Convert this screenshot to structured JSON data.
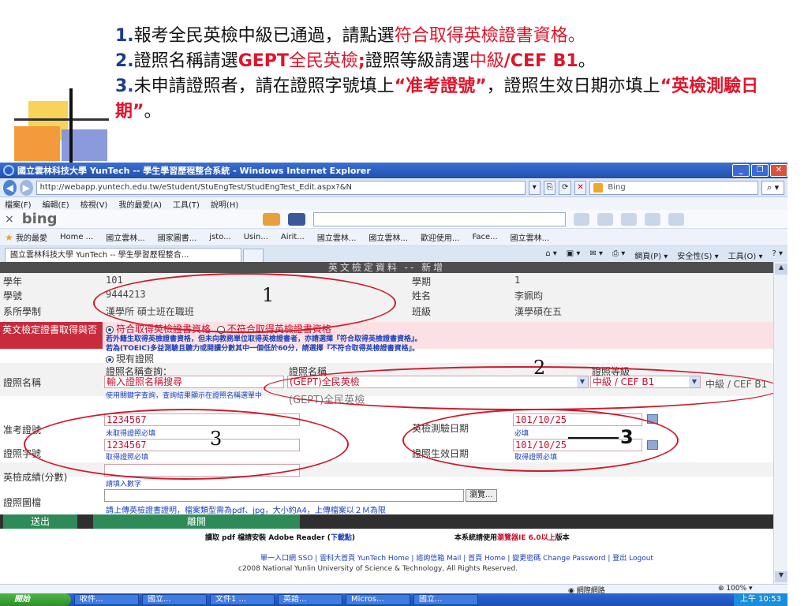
{
  "instructions": {
    "line1": {
      "num": "1.",
      "text": "報考全民英檢中級已通過，請點選",
      "red": "符合取得英檢證書資格",
      "end": "。"
    },
    "line2": {
      "num": "2.",
      "text1": "證照名稱請選",
      "bred1": "GEPT",
      "red1": "全民英檢",
      "bred2": ";",
      "text2": "證照等級請選",
      "red2": "中級",
      "bred3": "/CEF B1",
      "end": "。"
    },
    "line3": {
      "num": "3.",
      "text1": "未申請證照者，請在證照字號填上",
      "bred1": "“准考證號”",
      "text2": "，證照生效日期亦填上",
      "bred2": "“英檢測驗日期”",
      "end": "。"
    }
  },
  "window": {
    "title": "國立雲林科技大學 YunTech -- 學生學習歷程整合系統 - Windows Internet Explorer",
    "url": "http://webapp.yuntech.edu.tw/eStudent/StuEngTest/StudEngTest_Edit.aspx?&N",
    "search_placeholder": "Bing",
    "menu": [
      "檔案(F)",
      "編輯(E)",
      "檢視(V)",
      "我的最愛(A)",
      "工具(T)",
      "說明(H)"
    ],
    "bing_logo": "bing",
    "favorites_label": "我的最愛",
    "favorites": [
      "Home ...",
      "國立雲林...",
      "國家圖書...",
      "jsto...",
      "Usin...",
      "Airit...",
      "國立雲林...",
      "國立雲林...",
      "歡迎使用...",
      "Face...",
      "國立雲林..."
    ],
    "tab_title": "國立雲林科技大學 YunTech -- 學生學習歷程整合...",
    "cmd": [
      "網頁(P) ▾",
      "安全性(S) ▾",
      "工具(O) ▾"
    ]
  },
  "form": {
    "title": "英文檢定資料 -- 新增",
    "year_label": "學年",
    "year": "101",
    "term_label": "學期",
    "term": "1",
    "id_label": "學號",
    "id": "9444213",
    "name_label": "姓名",
    "name": "李姵昀",
    "dept_label": "系所學制",
    "dept": "漢學所 碩士班在職班",
    "class_label": "班級",
    "class": "漢學碩在五",
    "eligibility_label": "英文檢定證書取得與否",
    "eligible_option": "符合取得英檢證書資格",
    "ineligible_option": "不符合取得英檢證書資格",
    "note1": "若外籍生取得英檢證書資格，但未向教務單位取得英檢證書者，亦請選擇『符合取得英檢證書資格』。",
    "note2": "若為(TOEIC)多益測驗且聽力或閱讀分數其中一個低於60分，請選擇『不符合取得英檢證書資格』。",
    "existing_cert": "現有證照",
    "cert_name_label": "證照名稱",
    "cert_search_label": "證照名稱查詢：",
    "cert_search_value": "輸入證照名稱搜尋",
    "cert_search_hint": "使用關鍵字查詢，查詢結果顯示在證照名稱選單中",
    "cert_name_col": "證照名稱",
    "cert_name_value": "(GEPT)全民英檢",
    "cert_name_echo": "(GEPT)全民英檢",
    "cert_level_label": "證照等級",
    "cert_level_value": "中級 / CEF B1",
    "cert_level_echo": "中級 / CEF B1",
    "admission_label": "准考證號",
    "admission_value": "1234567",
    "admission_hint": "未取得證照必填",
    "exam_date_label": "英檢測驗日期",
    "exam_date_value": "101/10/25",
    "exam_date_hint": "必填",
    "cert_no_label": "證照字號",
    "cert_no_value": "1234567",
    "cert_no_hint": "取得證照必填",
    "effective_label": "證照生效日期",
    "effective_value": "101/10/25",
    "effective_hint": "取得證照必填",
    "score_label": "英檢成績(分數)",
    "score_hint": "請填入數字",
    "file_label": "證照圖檔",
    "browse": "瀏覽...",
    "file_hint": "請上傳英檢證書證明，檔案類型需為pdf、jpg，大小約A4，上傳檔案以２Ｍ為限",
    "submit": "送出",
    "leave": "離開"
  },
  "footer": {
    "pdf_text": "讀取 pdf 檔請安裝 Adobe Reader (",
    "pdf_link": "下載點",
    "pdf_end": ")",
    "browser_text": "本系統請使用",
    "browser_red": "瀏覽器IE 6.0以上",
    "browser_end": "版本",
    "links": "單一入口網 SSO | 雲科大首頁 YunTech Home | 諮詢信箱 Mail | 首頁 Home | 變更密碼 Change Password | 登出 Logout",
    "copyright": "c2008 National Yunlin University of Science & Technology, All Rights Reserved."
  },
  "annotations": {
    "a1": "1",
    "a2": "2",
    "a3": "3",
    "a3b": "3"
  },
  "status": {
    "network": "網際網路",
    "zoom": "100%"
  },
  "taskbar": {
    "start": "開始",
    "tasks": [
      "收件...",
      "國立...",
      "文件1 ...",
      "英語...",
      "Micros...",
      "國立..."
    ],
    "clock": "上午 10:53"
  }
}
